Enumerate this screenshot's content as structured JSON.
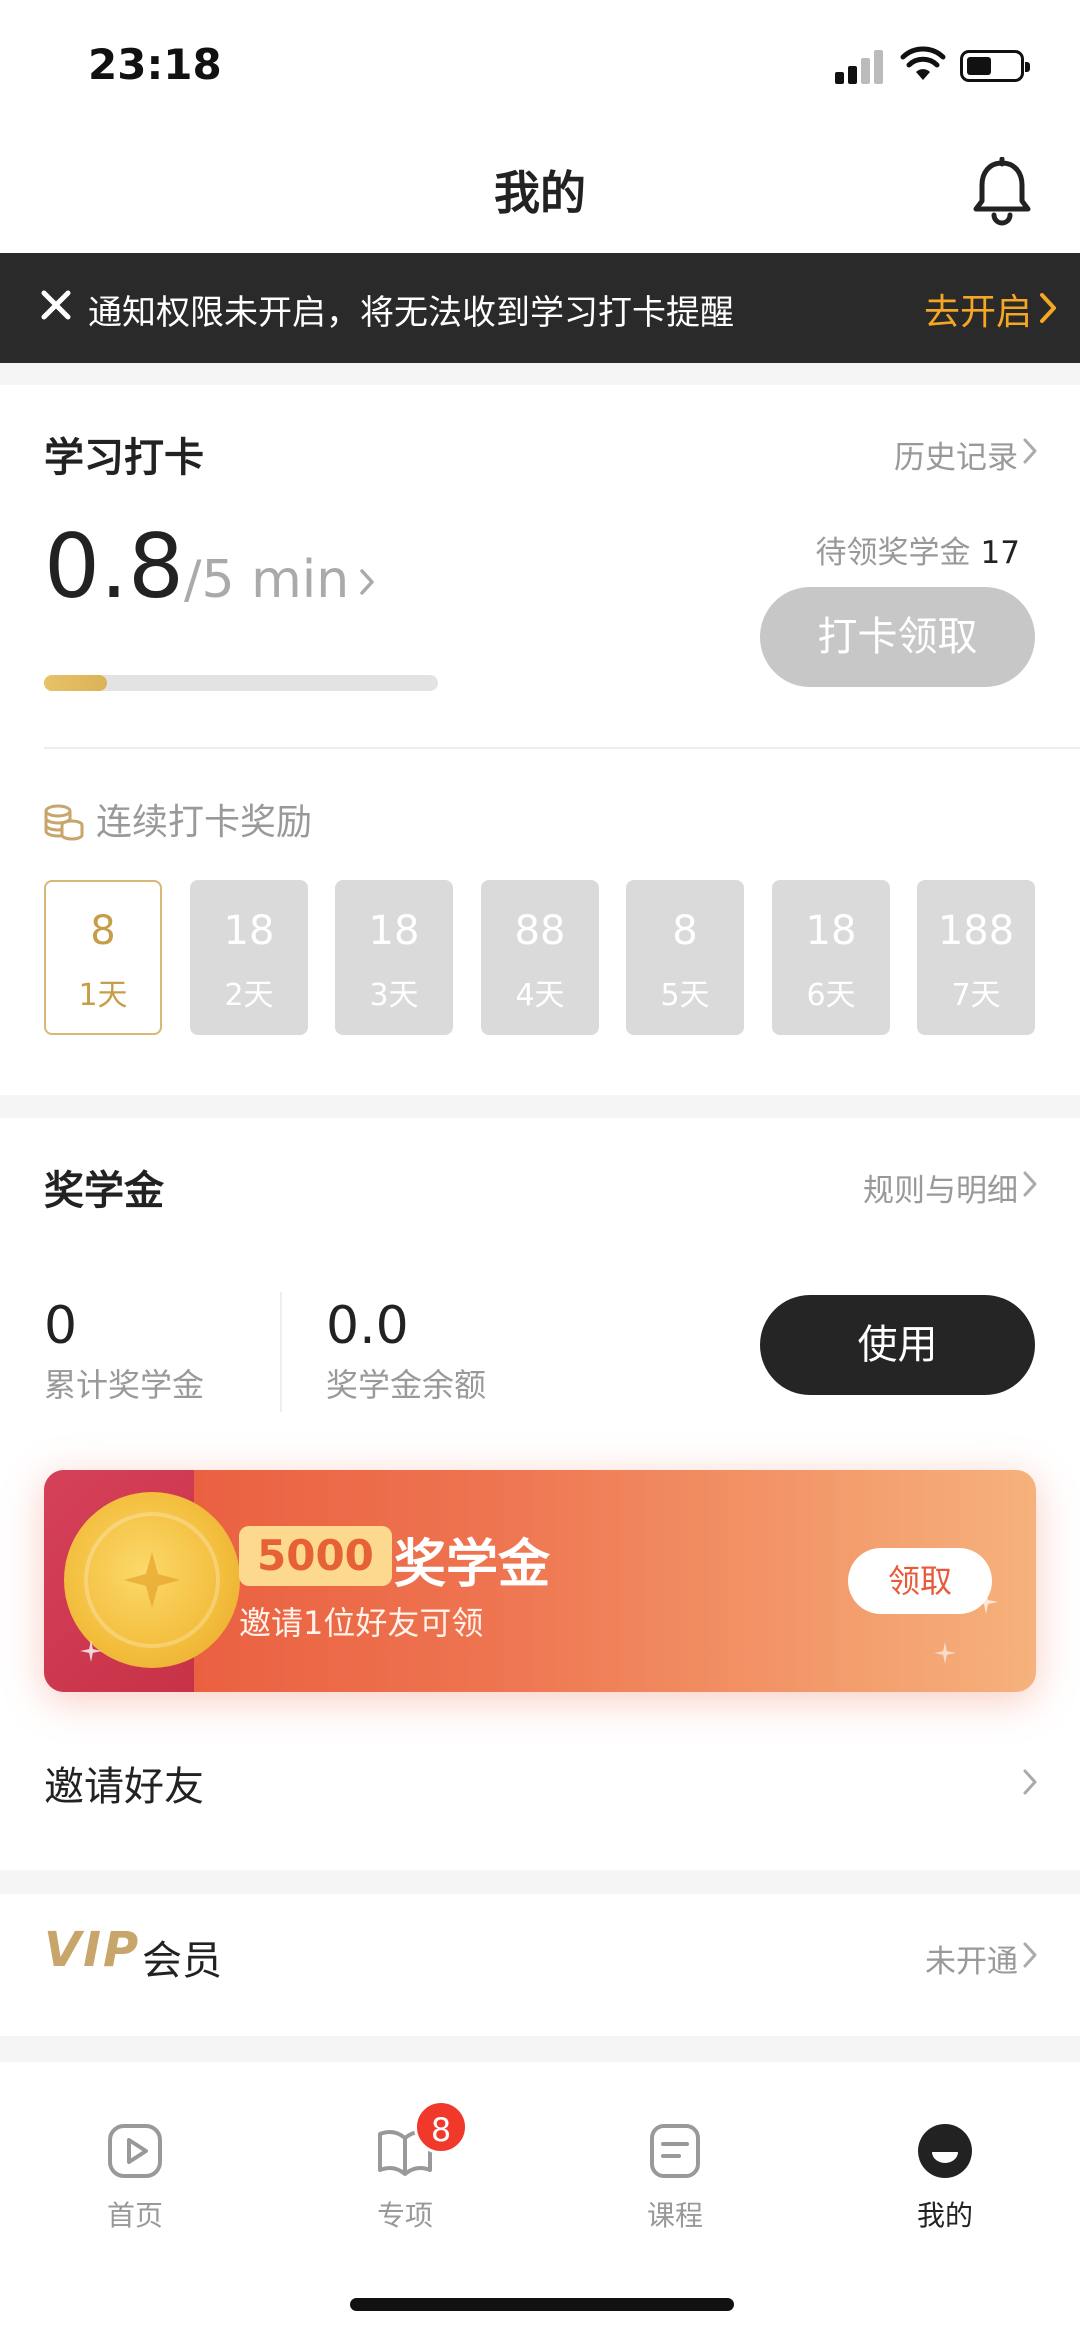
{
  "status": {
    "time": "23:18"
  },
  "header": {
    "title": "我的"
  },
  "notice": {
    "message": "通知权限未开启，将无法收到学习打卡提醒",
    "action": "去开启"
  },
  "checkin": {
    "title": "学习打卡",
    "history": "历史记录",
    "minutes_done": "0.8",
    "minutes_goal": "/5 min",
    "progress": 0.16,
    "pending_label": "待领奖学金",
    "pending_value": "17",
    "claim_button": "打卡领取",
    "reward_title": "连续打卡奖励",
    "days": [
      {
        "amount": "8",
        "label": "1天"
      },
      {
        "amount": "18",
        "label": "2天"
      },
      {
        "amount": "18",
        "label": "3天"
      },
      {
        "amount": "88",
        "label": "4天"
      },
      {
        "amount": "8",
        "label": "5天"
      },
      {
        "amount": "18",
        "label": "6天"
      },
      {
        "amount": "188",
        "label": "7天"
      }
    ]
  },
  "scholarship": {
    "title": "奖学金",
    "rules": "规则与明细",
    "total_value": "0",
    "total_label": "累计奖学金",
    "balance_value": "0.0",
    "balance_label": "奖学金余额",
    "use_button": "使用",
    "banner": {
      "amount": "5000",
      "title": "奖学金",
      "subtitle": "邀请1位好友可领",
      "claim": "领取"
    },
    "invite": "邀请好友"
  },
  "vip": {
    "word": "VIP",
    "label": "会员",
    "status": "未开通"
  },
  "tabbar": {
    "items": [
      {
        "label": "首页"
      },
      {
        "label": "专项",
        "badge": "8"
      },
      {
        "label": "课程"
      },
      {
        "label": "我的"
      }
    ]
  }
}
